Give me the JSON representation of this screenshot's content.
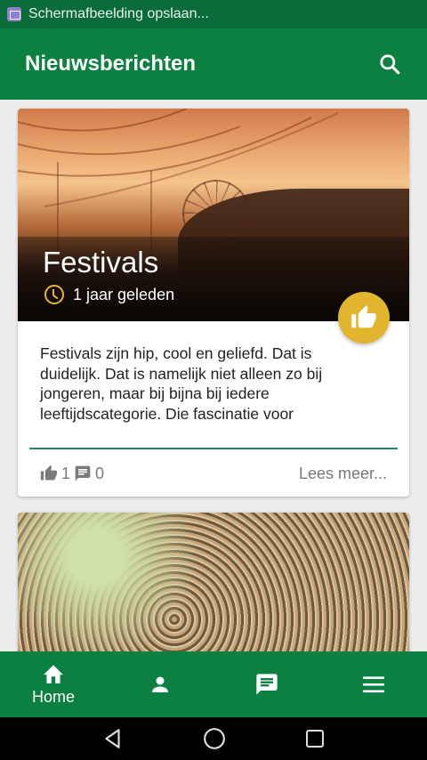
{
  "status_bar": {
    "notification_text": "Schermafbeelding opslaan..."
  },
  "app_bar": {
    "title": "Nieuwsberichten"
  },
  "articles": [
    {
      "title": "Festivals",
      "time_ago": "1 jaar geleden",
      "excerpt": "Festivals zijn hip, cool en geliefd. Dat is duidelijk. Dat is namelijk niet alleen zo bij jongeren, maar bij bijna bij iedere leeftijdscategorie. Die fascinatie voor",
      "likes": "1",
      "comments": "0",
      "read_more": "Lees meer..."
    }
  ],
  "bottom_nav": {
    "home_label": "Home"
  },
  "colors": {
    "primary": "#0b8040",
    "status_bar": "#0a6b3a",
    "accent": "#e2b52e"
  }
}
